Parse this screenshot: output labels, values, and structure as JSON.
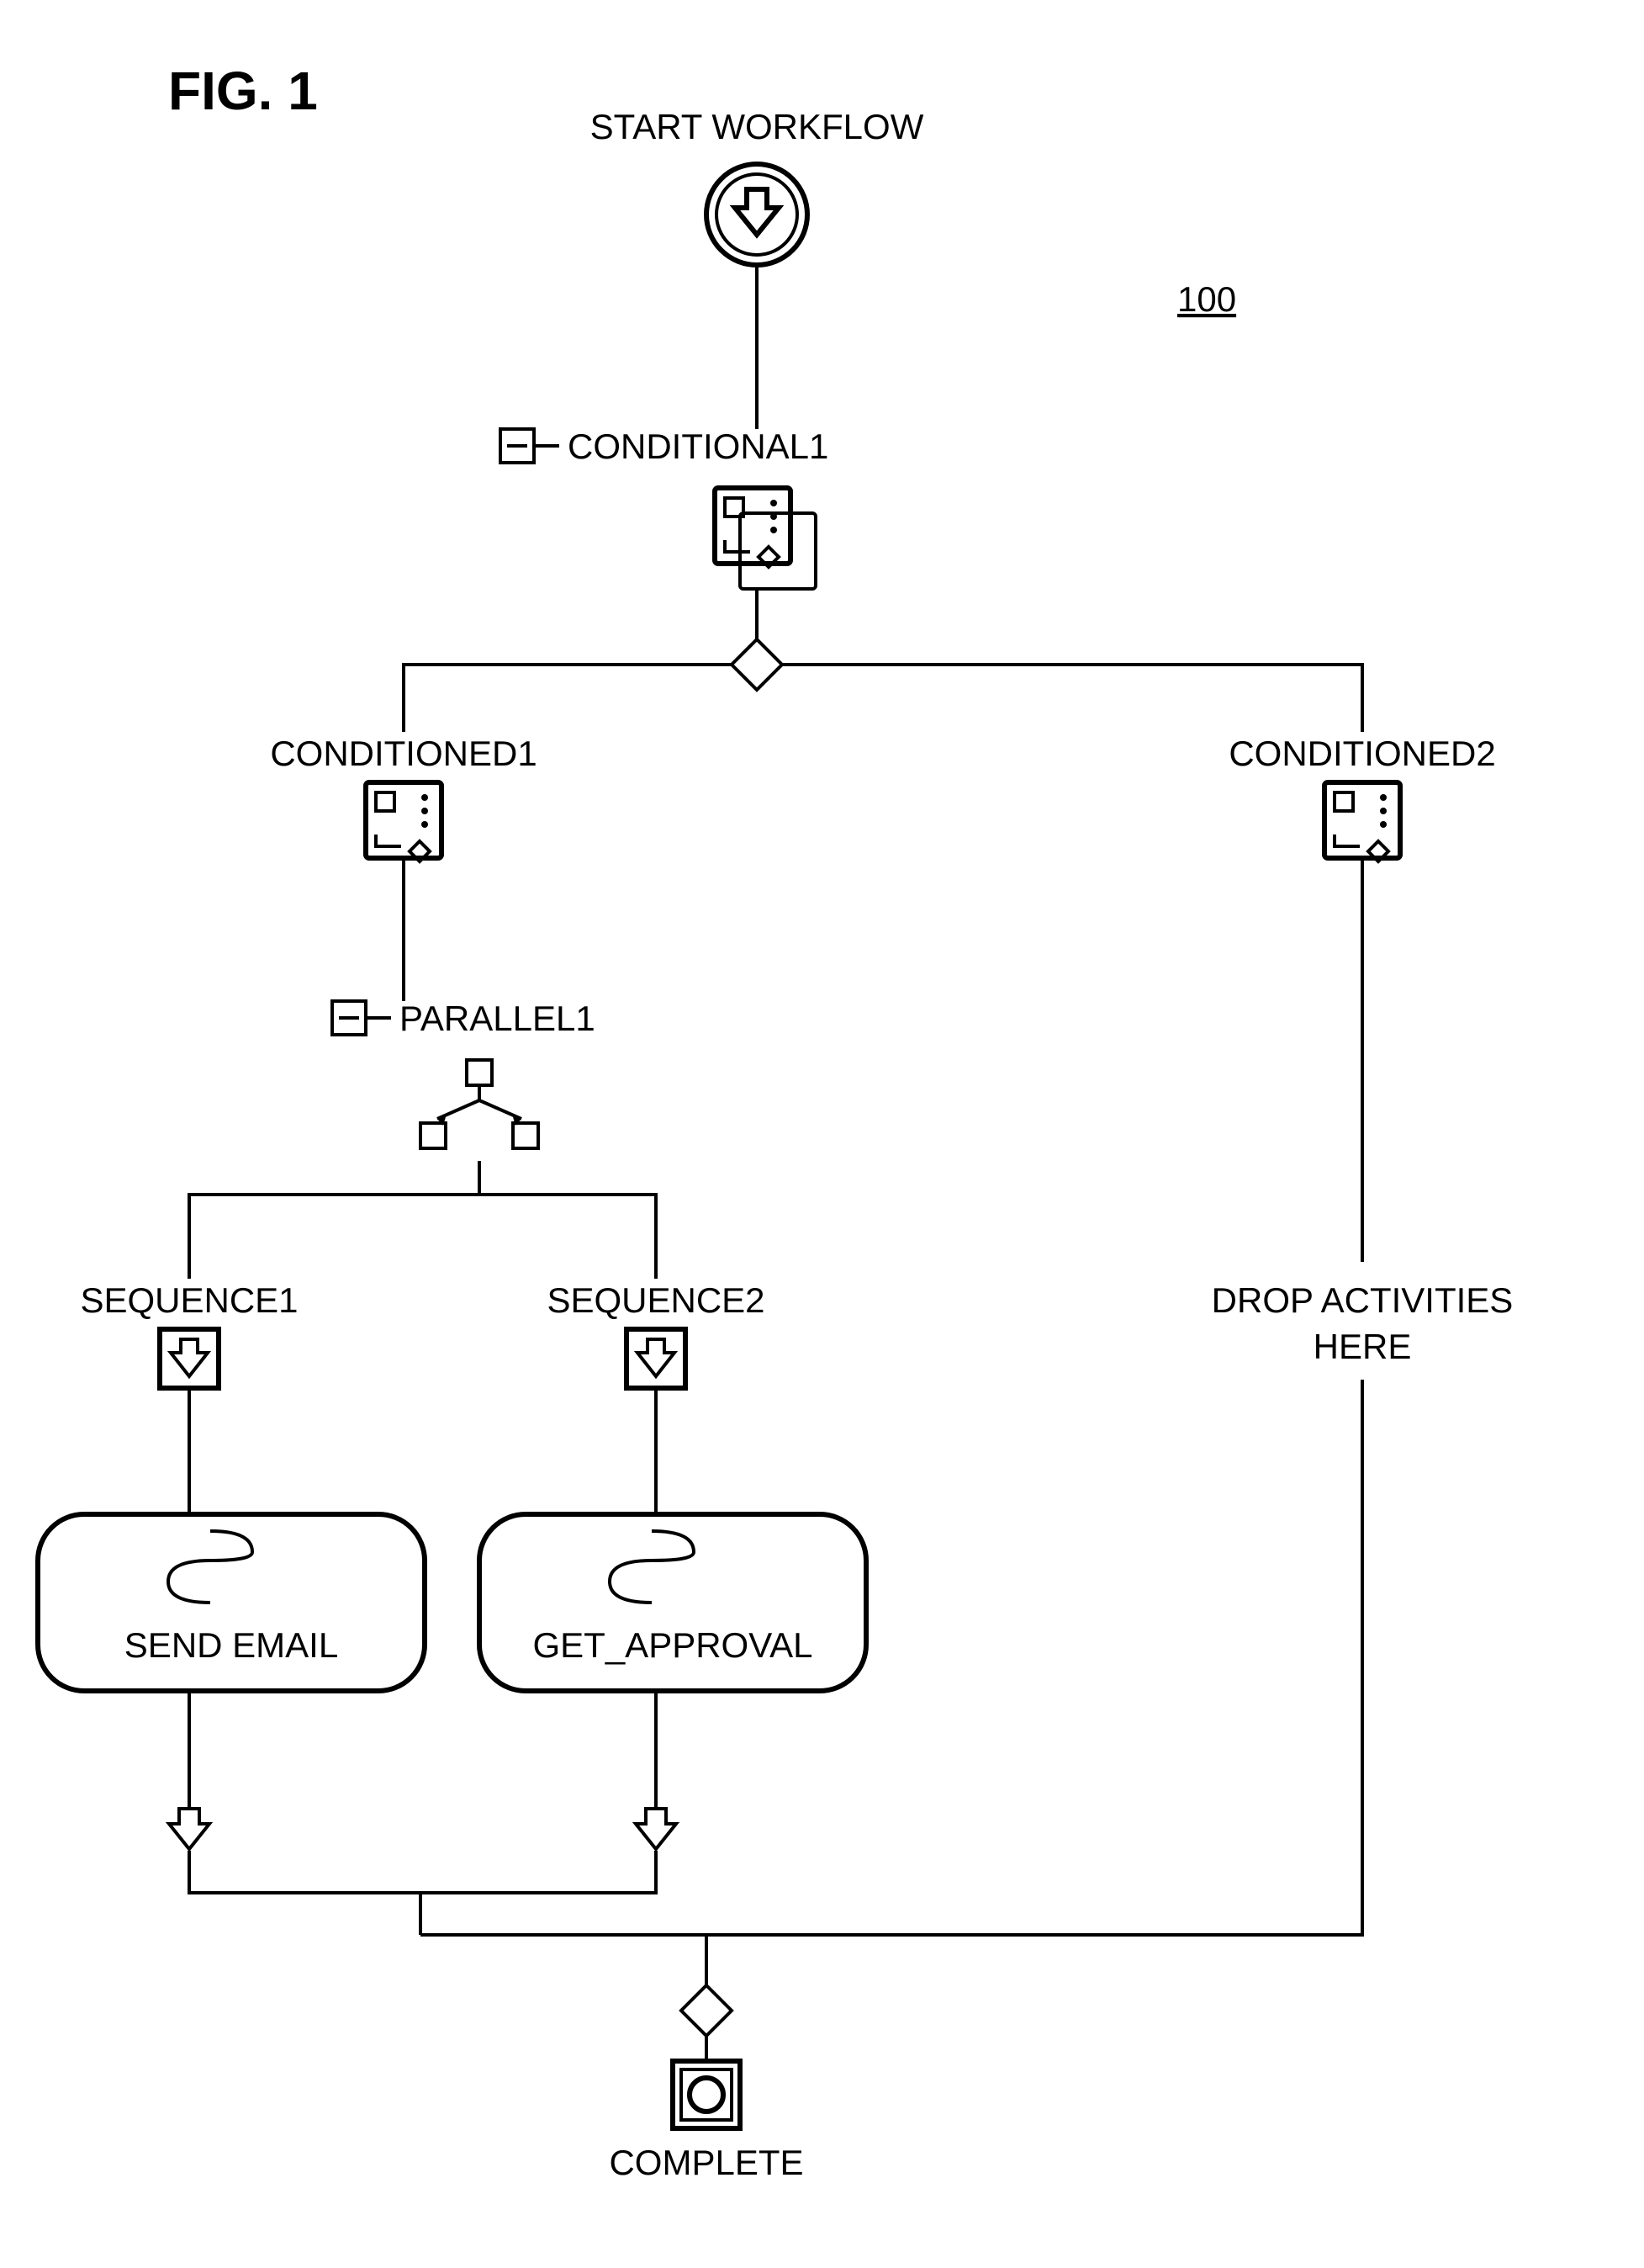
{
  "figure_label": "FIG. 1",
  "reference_number": "100",
  "start_label": "START WORKFLOW",
  "conditional_label": "CONDITIONAL1",
  "branch_left_label": "CONDITIONED1",
  "branch_right_label": "CONDITIONED2",
  "parallel_label": "PARALLEL1",
  "sequence1_label": "SEQUENCE1",
  "sequence2_label": "SEQUENCE2",
  "activity1_label": "SEND EMAIL",
  "activity2_label": "GET_APPROVAL",
  "drop_label_line1": "DROP ACTIVITIES",
  "drop_label_line2": "HERE",
  "complete_label": "COMPLETE"
}
